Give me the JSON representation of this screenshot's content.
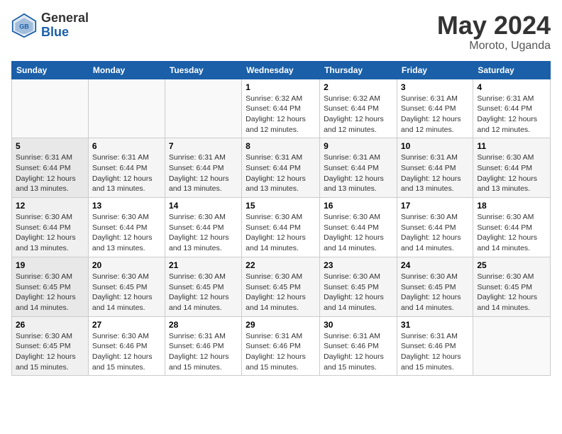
{
  "logo": {
    "general": "General",
    "blue": "Blue"
  },
  "title": "May 2024",
  "location": "Moroto, Uganda",
  "days_of_week": [
    "Sunday",
    "Monday",
    "Tuesday",
    "Wednesday",
    "Thursday",
    "Friday",
    "Saturday"
  ],
  "weeks": [
    [
      {
        "day": "",
        "info": ""
      },
      {
        "day": "",
        "info": ""
      },
      {
        "day": "",
        "info": ""
      },
      {
        "day": "1",
        "info": "Sunrise: 6:32 AM\nSunset: 6:44 PM\nDaylight: 12 hours and 12 minutes."
      },
      {
        "day": "2",
        "info": "Sunrise: 6:32 AM\nSunset: 6:44 PM\nDaylight: 12 hours and 12 minutes."
      },
      {
        "day": "3",
        "info": "Sunrise: 6:31 AM\nSunset: 6:44 PM\nDaylight: 12 hours and 12 minutes."
      },
      {
        "day": "4",
        "info": "Sunrise: 6:31 AM\nSunset: 6:44 PM\nDaylight: 12 hours and 12 minutes."
      }
    ],
    [
      {
        "day": "5",
        "info": "Sunrise: 6:31 AM\nSunset: 6:44 PM\nDaylight: 12 hours and 13 minutes."
      },
      {
        "day": "6",
        "info": "Sunrise: 6:31 AM\nSunset: 6:44 PM\nDaylight: 12 hours and 13 minutes."
      },
      {
        "day": "7",
        "info": "Sunrise: 6:31 AM\nSunset: 6:44 PM\nDaylight: 12 hours and 13 minutes."
      },
      {
        "day": "8",
        "info": "Sunrise: 6:31 AM\nSunset: 6:44 PM\nDaylight: 12 hours and 13 minutes."
      },
      {
        "day": "9",
        "info": "Sunrise: 6:31 AM\nSunset: 6:44 PM\nDaylight: 12 hours and 13 minutes."
      },
      {
        "day": "10",
        "info": "Sunrise: 6:31 AM\nSunset: 6:44 PM\nDaylight: 12 hours and 13 minutes."
      },
      {
        "day": "11",
        "info": "Sunrise: 6:30 AM\nSunset: 6:44 PM\nDaylight: 12 hours and 13 minutes."
      }
    ],
    [
      {
        "day": "12",
        "info": "Sunrise: 6:30 AM\nSunset: 6:44 PM\nDaylight: 12 hours and 13 minutes."
      },
      {
        "day": "13",
        "info": "Sunrise: 6:30 AM\nSunset: 6:44 PM\nDaylight: 12 hours and 13 minutes."
      },
      {
        "day": "14",
        "info": "Sunrise: 6:30 AM\nSunset: 6:44 PM\nDaylight: 12 hours and 13 minutes."
      },
      {
        "day": "15",
        "info": "Sunrise: 6:30 AM\nSunset: 6:44 PM\nDaylight: 12 hours and 14 minutes."
      },
      {
        "day": "16",
        "info": "Sunrise: 6:30 AM\nSunset: 6:44 PM\nDaylight: 12 hours and 14 minutes."
      },
      {
        "day": "17",
        "info": "Sunrise: 6:30 AM\nSunset: 6:44 PM\nDaylight: 12 hours and 14 minutes."
      },
      {
        "day": "18",
        "info": "Sunrise: 6:30 AM\nSunset: 6:44 PM\nDaylight: 12 hours and 14 minutes."
      }
    ],
    [
      {
        "day": "19",
        "info": "Sunrise: 6:30 AM\nSunset: 6:45 PM\nDaylight: 12 hours and 14 minutes."
      },
      {
        "day": "20",
        "info": "Sunrise: 6:30 AM\nSunset: 6:45 PM\nDaylight: 12 hours and 14 minutes."
      },
      {
        "day": "21",
        "info": "Sunrise: 6:30 AM\nSunset: 6:45 PM\nDaylight: 12 hours and 14 minutes."
      },
      {
        "day": "22",
        "info": "Sunrise: 6:30 AM\nSunset: 6:45 PM\nDaylight: 12 hours and 14 minutes."
      },
      {
        "day": "23",
        "info": "Sunrise: 6:30 AM\nSunset: 6:45 PM\nDaylight: 12 hours and 14 minutes."
      },
      {
        "day": "24",
        "info": "Sunrise: 6:30 AM\nSunset: 6:45 PM\nDaylight: 12 hours and 14 minutes."
      },
      {
        "day": "25",
        "info": "Sunrise: 6:30 AM\nSunset: 6:45 PM\nDaylight: 12 hours and 14 minutes."
      }
    ],
    [
      {
        "day": "26",
        "info": "Sunrise: 6:30 AM\nSunset: 6:45 PM\nDaylight: 12 hours and 15 minutes."
      },
      {
        "day": "27",
        "info": "Sunrise: 6:30 AM\nSunset: 6:46 PM\nDaylight: 12 hours and 15 minutes."
      },
      {
        "day": "28",
        "info": "Sunrise: 6:31 AM\nSunset: 6:46 PM\nDaylight: 12 hours and 15 minutes."
      },
      {
        "day": "29",
        "info": "Sunrise: 6:31 AM\nSunset: 6:46 PM\nDaylight: 12 hours and 15 minutes."
      },
      {
        "day": "30",
        "info": "Sunrise: 6:31 AM\nSunset: 6:46 PM\nDaylight: 12 hours and 15 minutes."
      },
      {
        "day": "31",
        "info": "Sunrise: 6:31 AM\nSunset: 6:46 PM\nDaylight: 12 hours and 15 minutes."
      },
      {
        "day": "",
        "info": ""
      }
    ]
  ]
}
